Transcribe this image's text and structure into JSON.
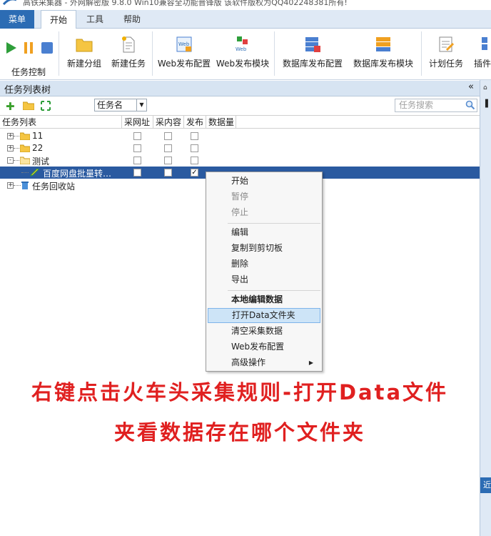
{
  "window": {
    "title": "高铁采集器 - 外网解密版 9.8.0 Win10兼容全功能普锋版 该软件版权为QQ402248381所有!"
  },
  "ribbon_tabs": [
    "菜单",
    "开始",
    "工具",
    "帮助"
  ],
  "control_group": {
    "label": "任务控制"
  },
  "ribbon_buttons": [
    {
      "label": "新建分组",
      "icon": "folder-icon"
    },
    {
      "label": "新建任务",
      "icon": "new-task-icon"
    },
    {
      "label": "Web发布配置",
      "icon": "web-config-icon"
    },
    {
      "label": "Web发布模块",
      "icon": "web-module-icon"
    },
    {
      "label": "数据库发布配置",
      "icon": "database-config-icon"
    },
    {
      "label": "数据库发布模块",
      "icon": "database-module-icon"
    },
    {
      "label": "计划任务",
      "icon": "schedule-icon"
    },
    {
      "label": "插件",
      "icon": "plugin-icon"
    }
  ],
  "panel": {
    "title": "任务列表树",
    "collapse": "«",
    "sort_select": "任务名",
    "search_placeholder": "任务搜索"
  },
  "columns": [
    "任务列表",
    "采网址",
    "采内容",
    "发布",
    "数据量"
  ],
  "tree": [
    {
      "label": "11",
      "expander": "+",
      "gather_url": false,
      "gather_content": false,
      "publish": false
    },
    {
      "label": "22",
      "expander": "+",
      "gather_url": false,
      "gather_content": false,
      "publish": false
    },
    {
      "label": "测试",
      "expander": "-",
      "gather_url": false,
      "gather_content": false,
      "publish": false
    },
    {
      "label": "百度网盘批量转…",
      "selected": true,
      "gather_url": false,
      "gather_content": false,
      "publish": true
    },
    {
      "label": "任务回收站",
      "expander": "+"
    }
  ],
  "context_menu": {
    "items": [
      {
        "label": "开始",
        "state": "enabled"
      },
      {
        "label": "暂停",
        "state": "disabled"
      },
      {
        "label": "停止",
        "state": "disabled"
      },
      {
        "label": "编辑",
        "state": "enabled"
      },
      {
        "label": "复制到剪切板",
        "state": "enabled"
      },
      {
        "label": "删除",
        "state": "enabled"
      },
      {
        "label": "导出",
        "state": "enabled"
      },
      {
        "label": "本地编辑数据",
        "state": "bold"
      },
      {
        "label": "打开Data文件夹",
        "state": "highlighted"
      },
      {
        "label": "清空采集数据",
        "state": "enabled"
      },
      {
        "label": "Web发布配置",
        "state": "enabled"
      },
      {
        "label": "高级操作",
        "state": "submenu",
        "arrow": "▶"
      }
    ]
  },
  "annotation": {
    "line1": "右键点击火车头采集规则-打开Data文件",
    "line2": "夹看数据存在哪个文件夹",
    "color": "#e02020"
  },
  "right_strip": {
    "tab_text": "近"
  }
}
